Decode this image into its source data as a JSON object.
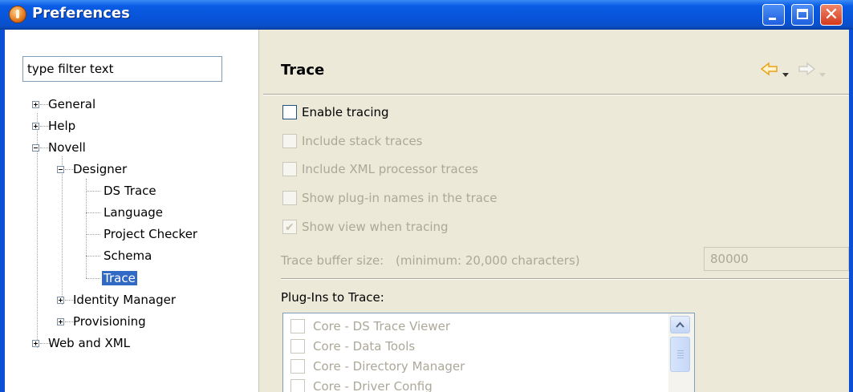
{
  "window": {
    "title": "Preferences",
    "controls": {
      "minimize": "minimize",
      "maximize": "maximize",
      "close": "✕"
    }
  },
  "filter": {
    "placeholder": "type filter text",
    "value": "type filter text"
  },
  "tree": {
    "general": "General",
    "help": "Help",
    "novell": "Novell",
    "designer": "Designer",
    "ds_trace": "DS Trace",
    "language": "Language",
    "project_checker": "Project Checker",
    "schema": "Schema",
    "trace": "Trace",
    "identity_manager": "Identity Manager",
    "provisioning": "Provisioning",
    "web_and_xml": "Web and XML",
    "selected": "Trace"
  },
  "page": {
    "title": "Trace",
    "nav": {
      "back_icon": "back-arrow-icon",
      "forward_icon": "forward-arrow-icon"
    },
    "enable_tracing": {
      "label": "Enable tracing",
      "checked": false
    },
    "include_stack": {
      "label": "Include stack traces",
      "checked": false,
      "disabled": true
    },
    "include_xml": {
      "label": "Include XML processor traces",
      "checked": false,
      "disabled": true
    },
    "show_plugin_names": {
      "label": "Show plug-in names in the trace",
      "checked": false,
      "disabled": true
    },
    "show_view": {
      "label": "Show view when tracing",
      "checked": true,
      "disabled": true
    },
    "buffer": {
      "label": "Trace buffer size:",
      "hint": "(minimum: 20,000 characters)",
      "value": "80000"
    },
    "plugins_label": "Plug-Ins to Trace:",
    "plugins": [
      "Core - DS Trace Viewer",
      "Core - Data Tools",
      "Core - Directory Manager",
      "Core - Driver Config"
    ]
  },
  "colors": {
    "titlebar": "#0754d9",
    "selection": "#316ac5",
    "disabled_text": "#aca899",
    "nav_arrow": "#e8a317"
  }
}
